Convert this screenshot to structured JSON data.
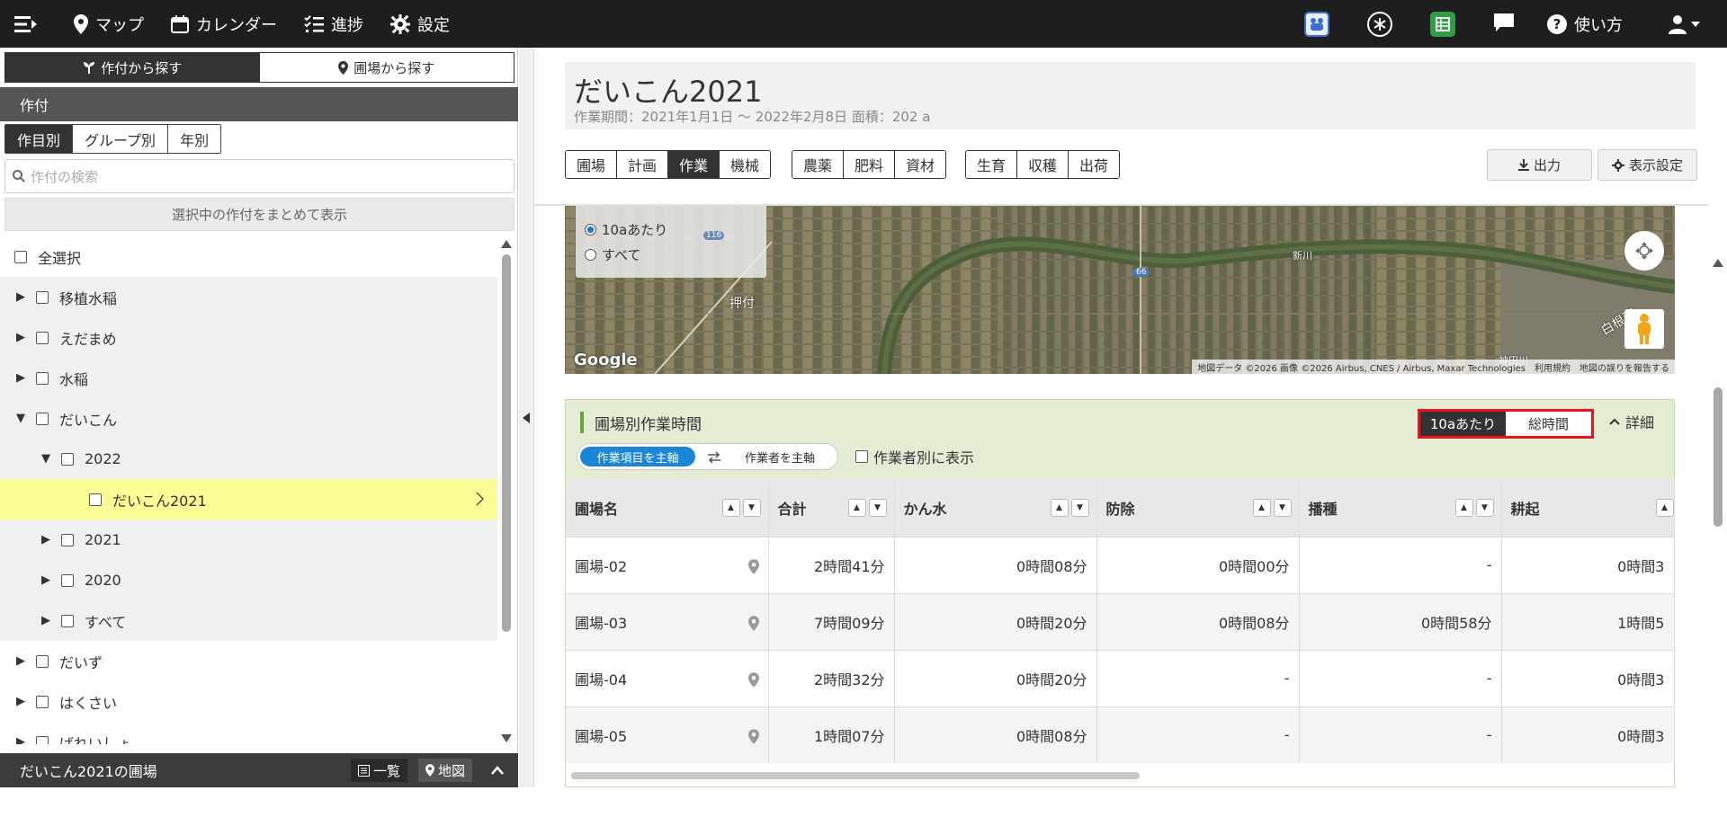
{
  "nav": {
    "map": "マップ",
    "calendar": "カレンダー",
    "progress": "進捗",
    "settings": "設定",
    "help": "使い方"
  },
  "sidebar": {
    "search_by_crop": "作付から探す",
    "search_by_field": "圃場から探す",
    "section_title": "作付",
    "tabs": [
      "作目別",
      "グループ別",
      "年別"
    ],
    "search_placeholder": "作付の検索",
    "show_selected": "選択中の作付をまとめて表示",
    "select_all": "全選択",
    "tree": [
      {
        "label": "移植水稲",
        "level": 0,
        "expanded": false
      },
      {
        "label": "えだまめ",
        "level": 0,
        "expanded": false
      },
      {
        "label": "水稲",
        "level": 0,
        "expanded": false
      },
      {
        "label": "だいこん",
        "level": 0,
        "expanded": true
      },
      {
        "label": "2022",
        "level": 1,
        "expanded": true
      },
      {
        "label": "だいこん2021",
        "level": 2,
        "selected": true
      },
      {
        "label": "2021",
        "level": 1,
        "expanded": false
      },
      {
        "label": "2020",
        "level": 1,
        "expanded": false
      },
      {
        "label": "すべて",
        "level": 1,
        "expanded": false
      },
      {
        "label": "だいず",
        "level": 0,
        "expanded": false
      },
      {
        "label": "はくさい",
        "level": 0,
        "expanded": false
      },
      {
        "label": "ばれいしょ",
        "level": 0,
        "expanded": false
      }
    ],
    "footer_title": "だいこん2021の圃場",
    "list_label": "一覧",
    "map_label": "地図"
  },
  "main": {
    "title": "だいこん2021",
    "subtitle": "作業期間：2021年1月1日 〜 2022年2月8日  面積：202 a",
    "tab_groups": [
      [
        "圃場",
        "計画",
        "作業",
        "機械"
      ],
      [
        "農薬",
        "肥料",
        "資材"
      ],
      [
        "生育",
        "収穫",
        "出荷"
      ]
    ],
    "active_tab": "作業",
    "export_label": "出力",
    "display_settings_label": "表示設定"
  },
  "map": {
    "radio_options": [
      "10aあたり",
      "すべて"
    ],
    "radio_selected": "10aあたり",
    "place_labels": [
      "押付",
      "新川",
      "白根西",
      "神田川"
    ],
    "road_labels": [
      "116",
      "66"
    ],
    "attribution": [
      "地図データ ©2026 画像 ©2026 Airbus, CNES / Airbus, Maxar Technologies",
      "利用規約",
      "地図の誤りを報告する"
    ],
    "google_logo": "Google"
  },
  "panel": {
    "title": "圃場別作業時間",
    "pill_on": "作業項目を主軸",
    "pill_off": "作業者を主軸",
    "worker_checkbox": "作業者別に表示",
    "unit_active": "10aあたり",
    "unit_inactive": "総時間",
    "detail_label": "詳細",
    "columns": [
      "圃場名",
      "合計",
      "かん水",
      "防除",
      "播種",
      "耕起"
    ],
    "rows": [
      [
        "圃場-02",
        "2時間41分",
        "0時間08分",
        "0時間00分",
        "-",
        "0時間3"
      ],
      [
        "圃場-03",
        "7時間09分",
        "0時間20分",
        "0時間08分",
        "0時間58分",
        "1時間5"
      ],
      [
        "圃場-04",
        "2時間32分",
        "0時間20分",
        "-",
        "-",
        "0時間3"
      ],
      [
        "圃場-05",
        "1時間07分",
        "0時間08分",
        "-",
        "-",
        "0時間3"
      ]
    ]
  },
  "colors": {
    "topbar": "#1e1e1e",
    "selected_row": "#fdfd96",
    "panel_header": "#e3edd4",
    "toggle_on": "#1a86d8",
    "highlight_border": "#e8141f"
  }
}
